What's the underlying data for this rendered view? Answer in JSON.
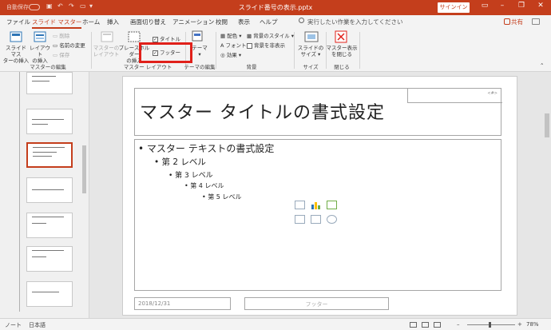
{
  "titlebar": {
    "autosave": "自動保存",
    "document_title": "スライド番号の表示.pptx",
    "signin_label": "サインイン"
  },
  "tabs": [
    {
      "label": "ファイル"
    },
    {
      "label": "スライド マスター"
    },
    {
      "label": "ホーム"
    },
    {
      "label": "挿入"
    },
    {
      "label": "画面切り替え"
    },
    {
      "label": "アニメーション"
    },
    {
      "label": "校閲"
    },
    {
      "label": "表示"
    },
    {
      "label": "ヘルプ"
    },
    {
      "label": "実行したい作業を入力してください"
    }
  ],
  "share_label": "共有",
  "ribbon": {
    "insert_master_l1": "スライド マス",
    "insert_master_l2": "ターの挿入",
    "insert_layout_l1": "レイアウト",
    "insert_layout_l2": "の挿入",
    "delete": "削除",
    "rename": "名前の変更",
    "preserve": "保存",
    "group_edit_master": "マスターの編集",
    "master_layout_l1": "マスターの",
    "master_layout_l2": "レイアウト",
    "insert_placeholder_l1": "プレースホルダー",
    "insert_placeholder_l2": "の挿入",
    "title_check": "タイトル",
    "footer_check": "フッター",
    "group_master_layout": "マスター レイアウト",
    "theme": "テーマ",
    "group_edit_theme": "テーマの編集",
    "colors": "配色",
    "fonts": "フォント",
    "effects": "効果",
    "background_styles": "背景のスタイル",
    "hide_background": "背景を非表示",
    "group_background": "背景",
    "slide_size_l1": "スライドの",
    "slide_size_l2": "サイズ",
    "group_size": "サイズ",
    "close_master_l1": "マスター表示",
    "close_master_l2": "を閉じる",
    "group_close": "閉じる"
  },
  "slide": {
    "title": "マスター タイトルの書式設定",
    "number_placeholder": "<#>",
    "levels": [
      "マスター テキストの書式設定",
      "第 2 レベル",
      "第 3 レベル",
      "第 4 レベル",
      "第 5 レベル"
    ],
    "date": "2018/12/31",
    "footer": "フッター"
  },
  "status": {
    "left": "ノート",
    "language": "日本語",
    "zoom": "78%"
  },
  "colors": {
    "brand": "#c43e1c",
    "highlight": "#e0201a"
  }
}
